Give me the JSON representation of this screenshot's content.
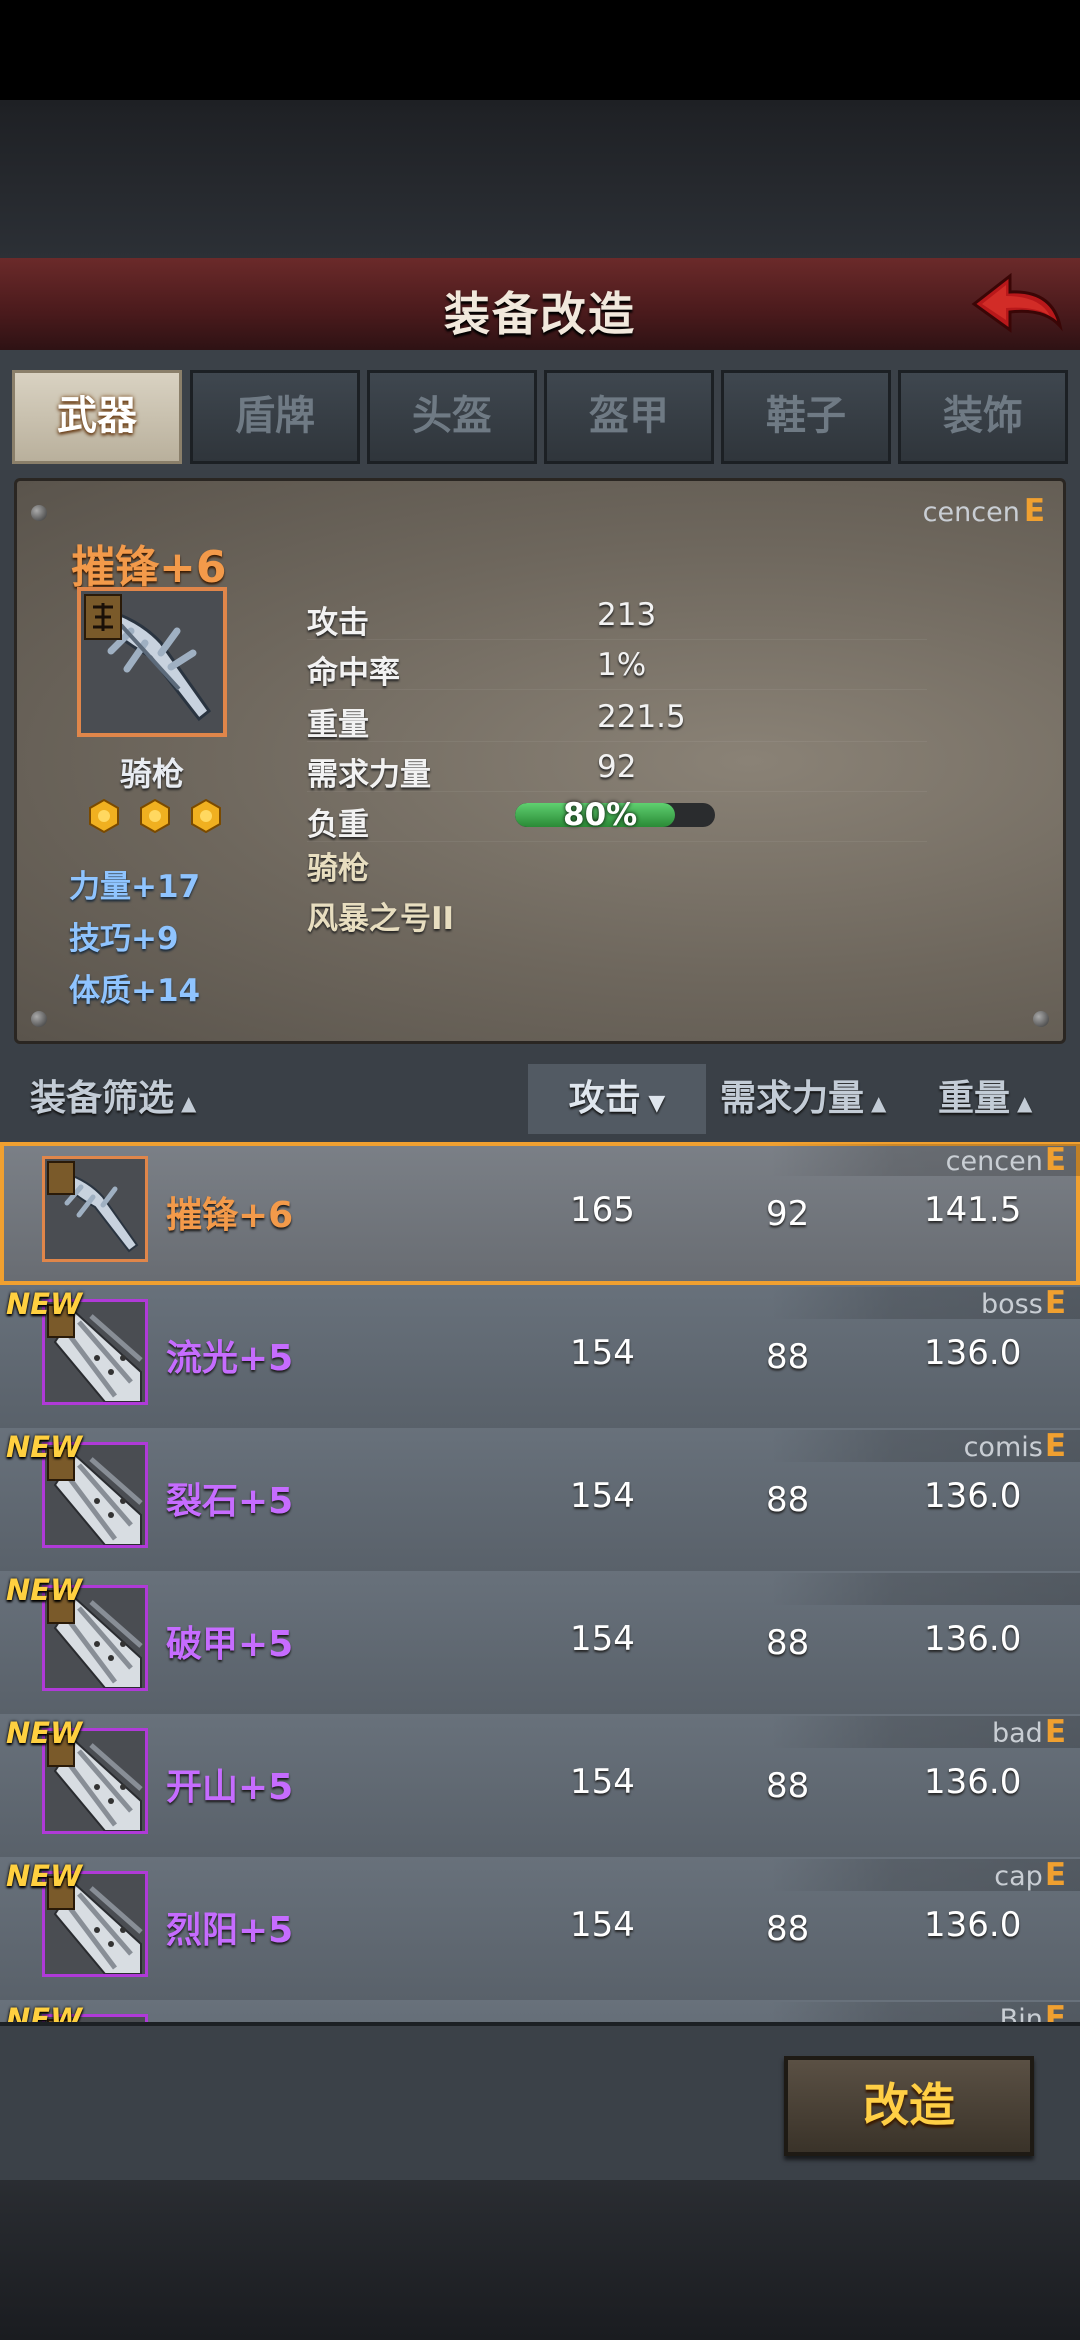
{
  "header": {
    "title": "装备改造"
  },
  "tabs": [
    {
      "label": "武器",
      "active": true
    },
    {
      "label": "盾牌",
      "active": false
    },
    {
      "label": "头盔",
      "active": false
    },
    {
      "label": "盔甲",
      "active": false
    },
    {
      "label": "鞋子",
      "active": false
    },
    {
      "label": "装饰",
      "active": false
    }
  ],
  "detail": {
    "owner": "cencen",
    "grade": "E",
    "name": "摧锋+6",
    "type": "骑枪",
    "stars": 3,
    "bonuses": [
      "力量+17",
      "技巧+9",
      "体质+14"
    ],
    "stats": [
      {
        "label": "攻击",
        "value": "213"
      },
      {
        "label": "命中率",
        "value": "1%"
      },
      {
        "label": "重量",
        "value": "221.5"
      },
      {
        "label": "需求力量",
        "value": "92"
      }
    ],
    "load": {
      "label": "负重",
      "value": "80%",
      "fraction": 0.8
    },
    "extras": [
      "骑枪",
      "风暴之号II"
    ]
  },
  "list_header": {
    "filter": "装备筛选",
    "attack": "攻击",
    "req_strength": "需求力量",
    "weight": "重量"
  },
  "items": [
    {
      "name": "摧锋+6",
      "owner": "cencen",
      "grade": "E",
      "atk": "165",
      "req": "92",
      "wt": "141.5",
      "new": false,
      "selected": true,
      "rarity": "orange"
    },
    {
      "name": "流光+5",
      "owner": "boss",
      "grade": "E",
      "atk": "154",
      "req": "88",
      "wt": "136.0",
      "new": true,
      "selected": false,
      "rarity": "purple"
    },
    {
      "name": "裂石+5",
      "owner": "comis",
      "grade": "E",
      "atk": "154",
      "req": "88",
      "wt": "136.0",
      "new": true,
      "selected": false,
      "rarity": "purple"
    },
    {
      "name": "破甲+5",
      "owner": "",
      "grade": "",
      "atk": "154",
      "req": "88",
      "wt": "136.0",
      "new": true,
      "selected": false,
      "rarity": "purple"
    },
    {
      "name": "开山+5",
      "owner": "bad",
      "grade": "E",
      "atk": "154",
      "req": "88",
      "wt": "136.0",
      "new": true,
      "selected": false,
      "rarity": "purple"
    },
    {
      "name": "烈阳+5",
      "owner": "cap",
      "grade": "E",
      "atk": "154",
      "req": "88",
      "wt": "136.0",
      "new": true,
      "selected": false,
      "rarity": "purple"
    },
    {
      "name": "",
      "owner": "Bin",
      "grade": "E",
      "atk": "",
      "req": "",
      "wt": "",
      "new": true,
      "selected": false,
      "rarity": "purple"
    }
  ],
  "new_badge": "NEW",
  "action": {
    "label": "改造"
  },
  "colors": {
    "accent_orange": "#f39a4a",
    "rare_purple": "#c66cff",
    "grade": "#f0a030",
    "header_red": "#6b2a2a"
  }
}
